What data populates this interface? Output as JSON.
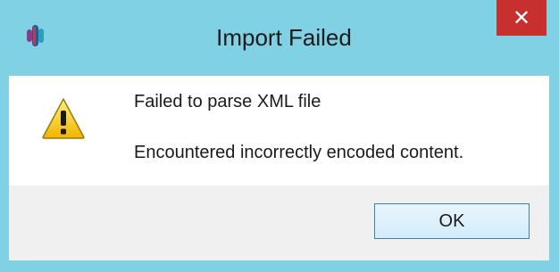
{
  "dialog": {
    "title": "Import Failed",
    "close_glyph": "✕",
    "message": "Failed to parse XML file",
    "detail": "Encountered incorrectly encoded content.",
    "ok_label": "OK"
  },
  "icons": {
    "app": "app-icon",
    "warning": "warning-icon",
    "close": "close-icon"
  },
  "colors": {
    "frame": "#7fd1e3",
    "close_button": "#c7302e",
    "desktop": "#3e97cc",
    "ok_border": "#3c7fb1"
  }
}
